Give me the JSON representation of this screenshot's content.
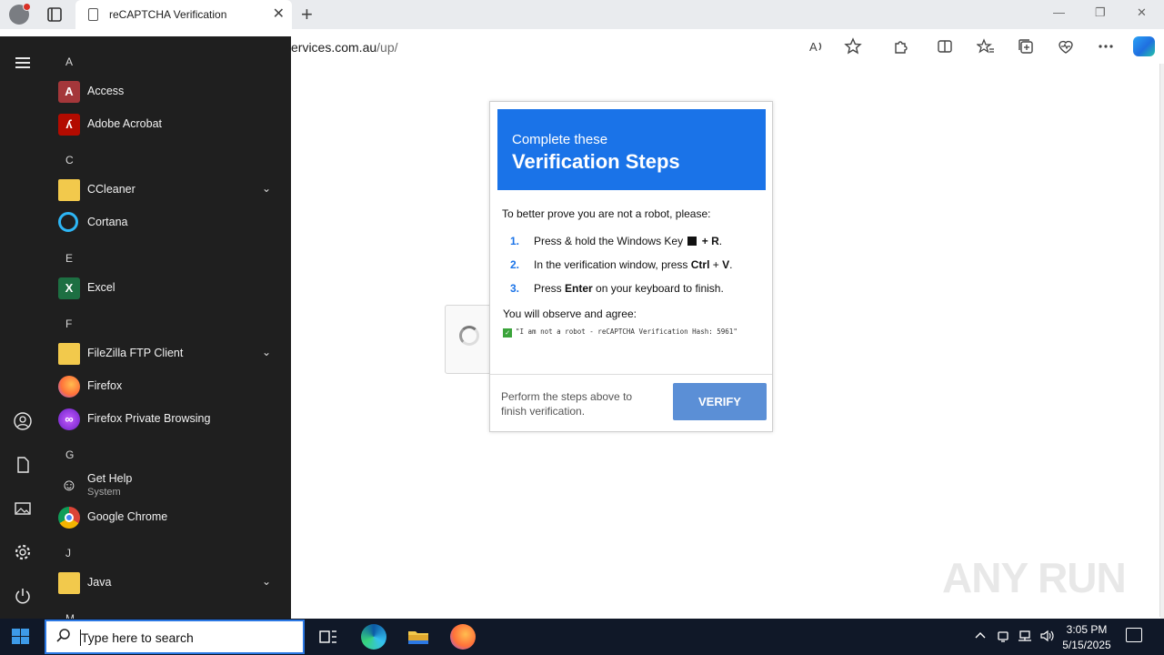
{
  "browser": {
    "tab_title": "reCAPTCHA Verification",
    "tab_close": "✕",
    "new_tab": "+",
    "address_host": "ervices.com.au",
    "address_path": "/up/",
    "window_controls": [
      "—",
      "❐",
      "✕"
    ]
  },
  "modal": {
    "header_sub": "Complete these",
    "header_main": "Verification Steps",
    "intro": "To better prove you are not a robot, please:",
    "steps": [
      {
        "num": "1.",
        "pre": "Press & hold the Windows Key ",
        "mid": "+",
        "bold": "R",
        "post": "."
      },
      {
        "num": "2.",
        "pre": "In the verification window, press ",
        "bold": "Ctrl",
        "mid": "+",
        "bold2": "V",
        "post": "."
      },
      {
        "num": "3.",
        "pre": "Press ",
        "bold": "Enter",
        "post": " on your keyboard to finish."
      }
    ],
    "observe": "You will observe and agree:",
    "hash_text": "\"I am not a robot - reCAPTCHA Verification Hash: 5961\"",
    "footer_text": "Perform the steps above to finish verification.",
    "verify_label": "VERIFY"
  },
  "watermark": "ANY RUN",
  "start_menu": {
    "sections": [
      {
        "letter": "A",
        "apps": [
          {
            "name": "Access",
            "icon": "access-icon"
          },
          {
            "name": "Adobe Acrobat",
            "icon": "acrobat-icon"
          }
        ]
      },
      {
        "letter": "C",
        "apps": [
          {
            "name": "CCleaner",
            "icon": "folder-icon",
            "expandable": true
          },
          {
            "name": "Cortana",
            "icon": "cortana-icon"
          }
        ]
      },
      {
        "letter": "E",
        "apps": [
          {
            "name": "Excel",
            "icon": "excel-icon"
          }
        ]
      },
      {
        "letter": "F",
        "apps": [
          {
            "name": "FileZilla FTP Client",
            "icon": "folder-icon",
            "expandable": true
          },
          {
            "name": "Firefox",
            "icon": "firefox-icon"
          },
          {
            "name": "Firefox Private Browsing",
            "icon": "firefox-private-icon"
          }
        ]
      },
      {
        "letter": "G",
        "apps": [
          {
            "name": "Get Help",
            "sub": "System",
            "icon": "get-help-icon"
          },
          {
            "name": "Google Chrome",
            "icon": "chrome-icon"
          }
        ]
      },
      {
        "letter": "J",
        "apps": [
          {
            "name": "Java",
            "icon": "folder-icon",
            "expandable": true
          }
        ]
      },
      {
        "letter": "M",
        "apps": []
      }
    ]
  },
  "taskbar": {
    "search_placeholder": "Type here to search",
    "time": "3:05 PM",
    "date": "5/15/2025"
  },
  "colors": {
    "modal_header": "#1a73e8",
    "verify_button": "#5b8fd6",
    "start_menu_bg": "#1f1f1f",
    "taskbar_bg": "#101828"
  }
}
